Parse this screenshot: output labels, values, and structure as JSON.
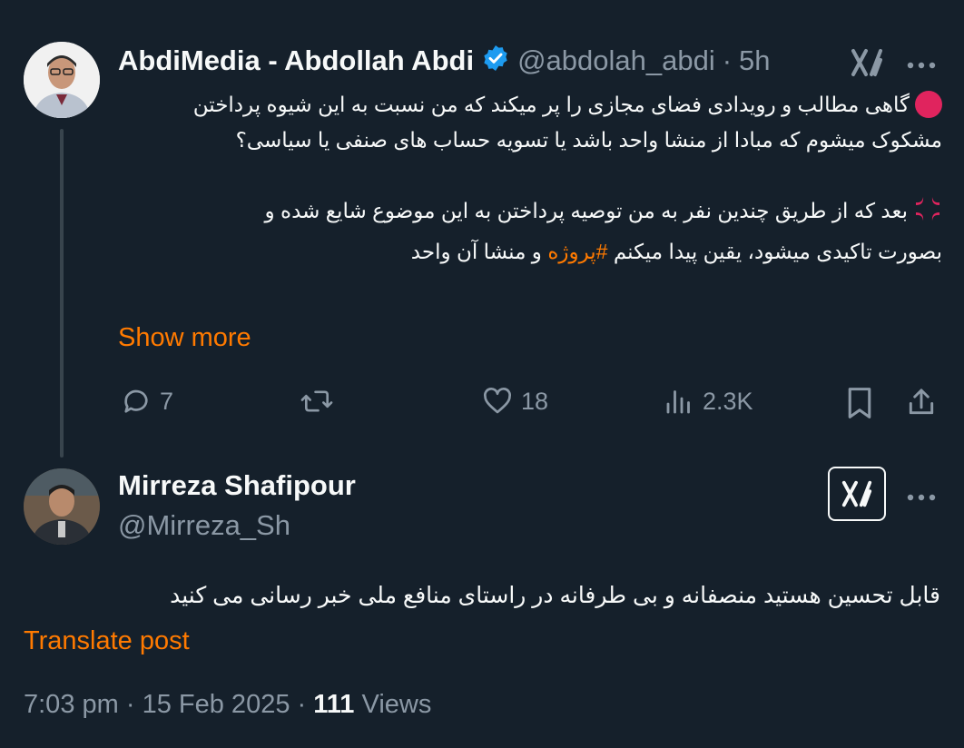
{
  "tweet": {
    "author_name": "AbdiMedia - Abdollah Abdi",
    "handle": "@abdolah_abdi",
    "separator": "·",
    "time": "5h",
    "para1": "گاهی مطالب و رویدادی فضای مجازی را پر میکند که من نسبت به این شیوه پرداختن مشکوک میشوم که مبادا از منشا واحد باشد یا تسویه حساب های صنفی یا سیاسی؟",
    "para2_line1": "بعد که از طریق چندین نفر به من توصیه پرداختن به این موضوع شایع شده و",
    "para2_line2_start": "بصورت تاکیدی میشود، یقین پیدا میکنم",
    "hashtag": "#پروژه",
    "para2_line2_end": "و منشا آن واحد",
    "show_more": "Show more",
    "replies": "7",
    "likes": "18",
    "views": "2.3K"
  },
  "reply": {
    "author_name": "Mirreza Shafipour",
    "handle": "@Mirreza_Sh",
    "text": "قابل تحسین هستید منصفانه و بی طرفانه در راستای منافع ملی خبر رسانی می کنید",
    "translate": "Translate post",
    "time": "7:03 pm",
    "dot1": "·",
    "date": "15 Feb 2025",
    "dot2": "·",
    "views_count": "111",
    "views_label": "Views"
  },
  "colors": {
    "background": "#15202b",
    "accent": "#ff7a00",
    "muted": "#8b98a5",
    "verified": "#1d9bf0",
    "red_circle": "#e0245e"
  },
  "icons": [
    "verified-badge-icon",
    "grok-icon",
    "more-icon",
    "red-circle-emoji",
    "anger-emoji",
    "reply-icon",
    "retweet-icon",
    "like-icon",
    "views-icon",
    "bookmark-icon",
    "share-icon"
  ]
}
